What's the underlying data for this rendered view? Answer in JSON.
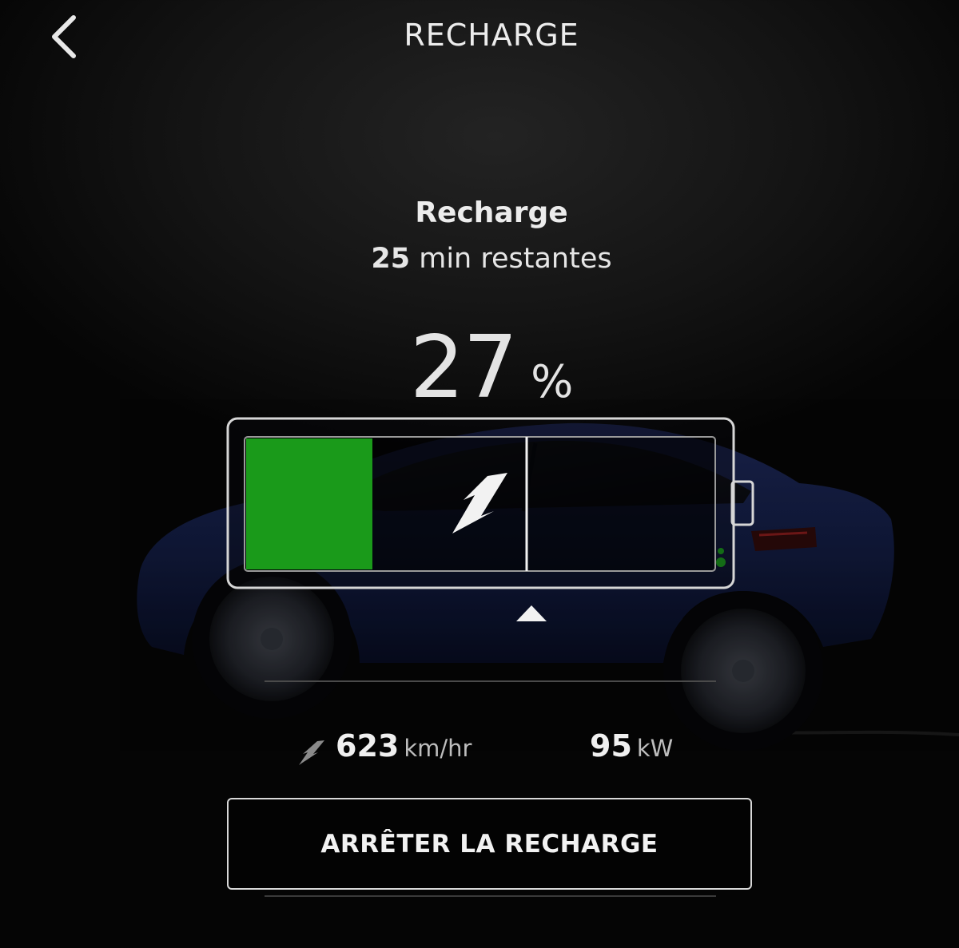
{
  "header": {
    "title": "RECHARGE",
    "back_icon": "chevron-left-icon"
  },
  "status": {
    "title": "Recharge",
    "time_remaining_value": "25",
    "time_remaining_label": "min restantes"
  },
  "battery": {
    "charge_value": "27",
    "charge_unit": "%",
    "charge_level": 0.27,
    "charge_limit": 0.6,
    "fill_color": "#1a9a1a",
    "center_icon": "lightning-bolt-icon"
  },
  "stats": {
    "rate_icon": "lightning-bolt-icon",
    "rate_value": "623",
    "rate_unit": "km/hr",
    "power_value": "95",
    "power_unit": "kW"
  },
  "actions": {
    "stop_label": "ARRÊTER LA RECHARGE"
  },
  "colors": {
    "background": "#050505",
    "text": "#ececec",
    "car_body": "#101a3a",
    "charge_green": "#1a9a1a"
  }
}
